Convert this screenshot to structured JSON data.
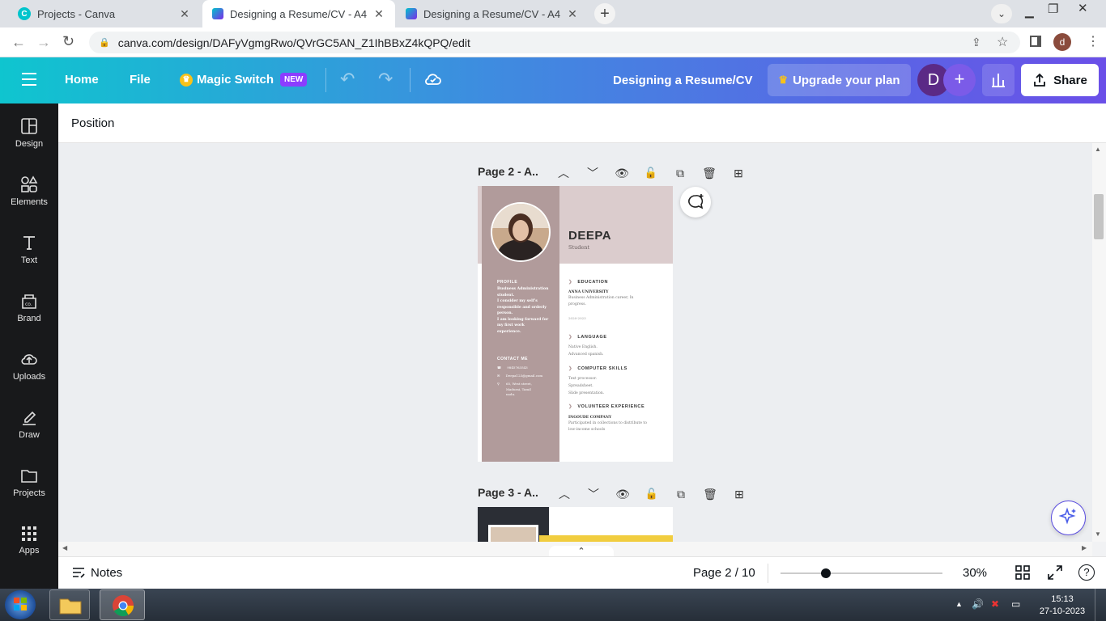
{
  "browser": {
    "tabs": [
      {
        "title": "Projects - Canva",
        "active": false
      },
      {
        "title": "Designing a Resume/CV - A4",
        "active": true
      },
      {
        "title": "Designing a Resume/CV - A4",
        "active": false
      }
    ],
    "url": "canva.com/design/DAFyVgmgRwo/QVrGC5AN_Z1IhBBxZ4kQPQ/edit",
    "profile_initial": "d"
  },
  "header": {
    "home": "Home",
    "file": "File",
    "magic_switch": "Magic Switch",
    "new_badge": "NEW",
    "doc_title": "Designing a Resume/CV",
    "upgrade": "Upgrade your plan",
    "avatar_initial": "D",
    "share": "Share"
  },
  "sidebar": {
    "items": [
      {
        "label": "Design",
        "icon": "design-icon"
      },
      {
        "label": "Elements",
        "icon": "elements-icon"
      },
      {
        "label": "Text",
        "icon": "text-icon"
      },
      {
        "label": "Brand",
        "icon": "brand-icon"
      },
      {
        "label": "Uploads",
        "icon": "uploads-icon"
      },
      {
        "label": "Draw",
        "icon": "draw-icon"
      },
      {
        "label": "Projects",
        "icon": "projects-icon"
      },
      {
        "label": "Apps",
        "icon": "apps-icon"
      }
    ]
  },
  "toolbar": {
    "position": "Position"
  },
  "pages": {
    "page2_label": "Page 2 - A..",
    "page3_label": "Page 3 - A.."
  },
  "resume": {
    "name": "DEEPA",
    "role": "Student",
    "profile_heading": "PROFILE",
    "profile_lines": [
      "Business Administration",
      "student.",
      "I consider my self's",
      "responsible and orderly",
      "person.",
      "I am looking forward for",
      "my first work",
      "experience."
    ],
    "contact_heading": "CONTACT ME",
    "phone": "9845763543",
    "email": "Deepa123@gmail.com",
    "address_lines": [
      "65, West street,",
      "Madurai, Tamil",
      "nadu."
    ],
    "education_heading": "EDUCATION",
    "education_school": "ANNA UNIVERSITY",
    "education_lines": [
      "Business Administration career, In",
      "progress."
    ],
    "education_years": "2020-2023",
    "language_heading": "LANGUAGE",
    "language_lines": [
      "Native English.",
      "Advanced spanish."
    ],
    "computer_heading": "COMPUTER SKILLS",
    "computer_lines": [
      "Text processor.",
      "Spreadsheet.",
      "Slide presentation."
    ],
    "volunteer_heading": "VOLUNTEER EXPERIENCE",
    "volunteer_org": "INGOUDE COMPANY",
    "volunteer_lines": [
      "Participated in collections to distribute to",
      "low-income schools"
    ]
  },
  "bottom": {
    "notes": "Notes",
    "page_indicator": "Page 2 / 10",
    "zoom": "30%",
    "zoom_level": 0.28
  },
  "taskbar": {
    "time": "15:13",
    "date": "27-10-2023"
  },
  "colors": {
    "resume_sidebar": "#b19b9b",
    "resume_header": "#dbcccd",
    "canva_purple": "#7d2ae8"
  }
}
